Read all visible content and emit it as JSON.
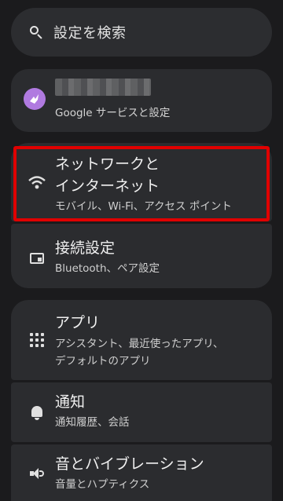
{
  "search": {
    "placeholder": "設定を検索",
    "icon": "search-icon"
  },
  "account": {
    "subtitle": "Google サービスと設定",
    "icon": "account-avatar-icon"
  },
  "items": [
    {
      "id": "network",
      "title_line1": "ネットワークと",
      "title_line2": "インターネット",
      "subtitle": "モバイル、Wi-Fi、アクセス ポイント",
      "icon": "wifi-icon"
    },
    {
      "id": "connected",
      "title": "接続設定",
      "subtitle": "Bluetooth、ペア設定",
      "icon": "connected-devices-icon"
    },
    {
      "id": "apps",
      "title": "アプリ",
      "subtitle_line1": "アシスタント、最近使ったアプリ、",
      "subtitle_line2": "デフォルトのアプリ",
      "icon": "apps-grid-icon"
    },
    {
      "id": "notifications",
      "title": "通知",
      "subtitle": "通知履歴、会話",
      "icon": "bell-icon"
    },
    {
      "id": "sound",
      "title": "音とバイブレーション",
      "subtitle": "音量とハプティクス",
      "icon": "speaker-icon"
    }
  ],
  "colors": {
    "background": "#1b1b1d",
    "card": "#2b2c2f",
    "highlight": "#e00000",
    "avatar": "#b07ae0"
  }
}
